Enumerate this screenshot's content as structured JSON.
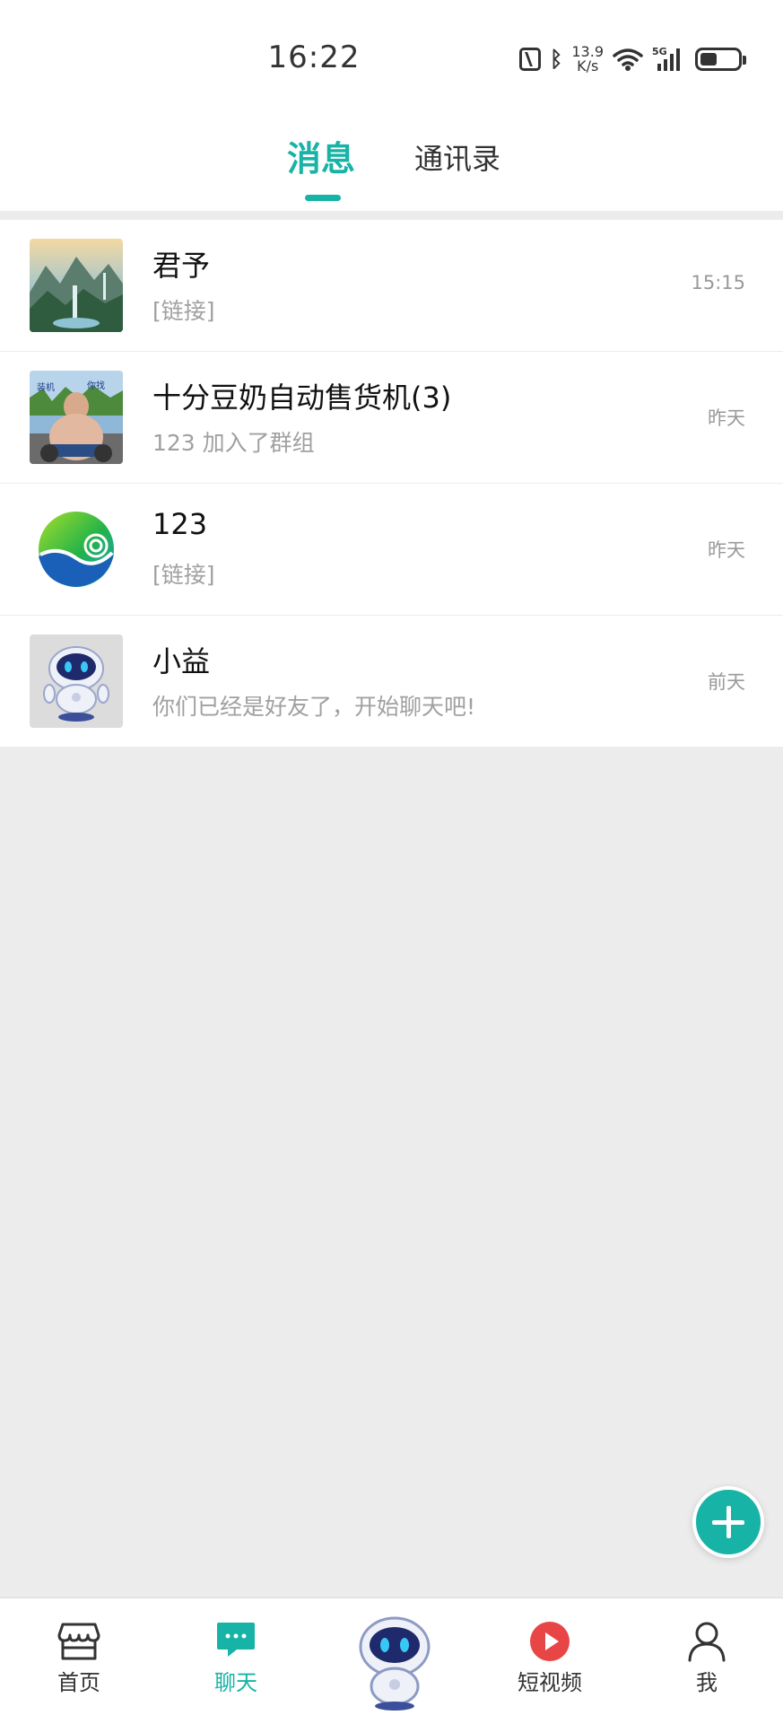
{
  "status_bar": {
    "time": "16:22",
    "net_speed_value": "13.9",
    "net_speed_unit": "K/s",
    "network": "5G",
    "icons": [
      "nfc-icon",
      "bluetooth-icon",
      "wifi-icon",
      "signal-icon",
      "battery-icon"
    ]
  },
  "tabs": {
    "messages": "消息",
    "contacts": "通讯录",
    "active": "messages"
  },
  "conversations": [
    {
      "name": "君予",
      "preview": "[链接]",
      "time": "15:15"
    },
    {
      "name": "十分豆奶自动售货机(3)",
      "preview": "123 加入了群组",
      "time": "昨天"
    },
    {
      "name": "123",
      "preview": "[链接]",
      "time": "昨天"
    },
    {
      "name": "小益",
      "preview": "你们已经是好友了，开始聊天吧!",
      "time": "前天"
    }
  ],
  "bottom_nav": {
    "home": "首页",
    "chat": "聊天",
    "video": "短视频",
    "me": "我",
    "active": "chat"
  },
  "colors": {
    "accent": "#17b3a6",
    "background": "#ececec",
    "video_red": "#e84646"
  }
}
